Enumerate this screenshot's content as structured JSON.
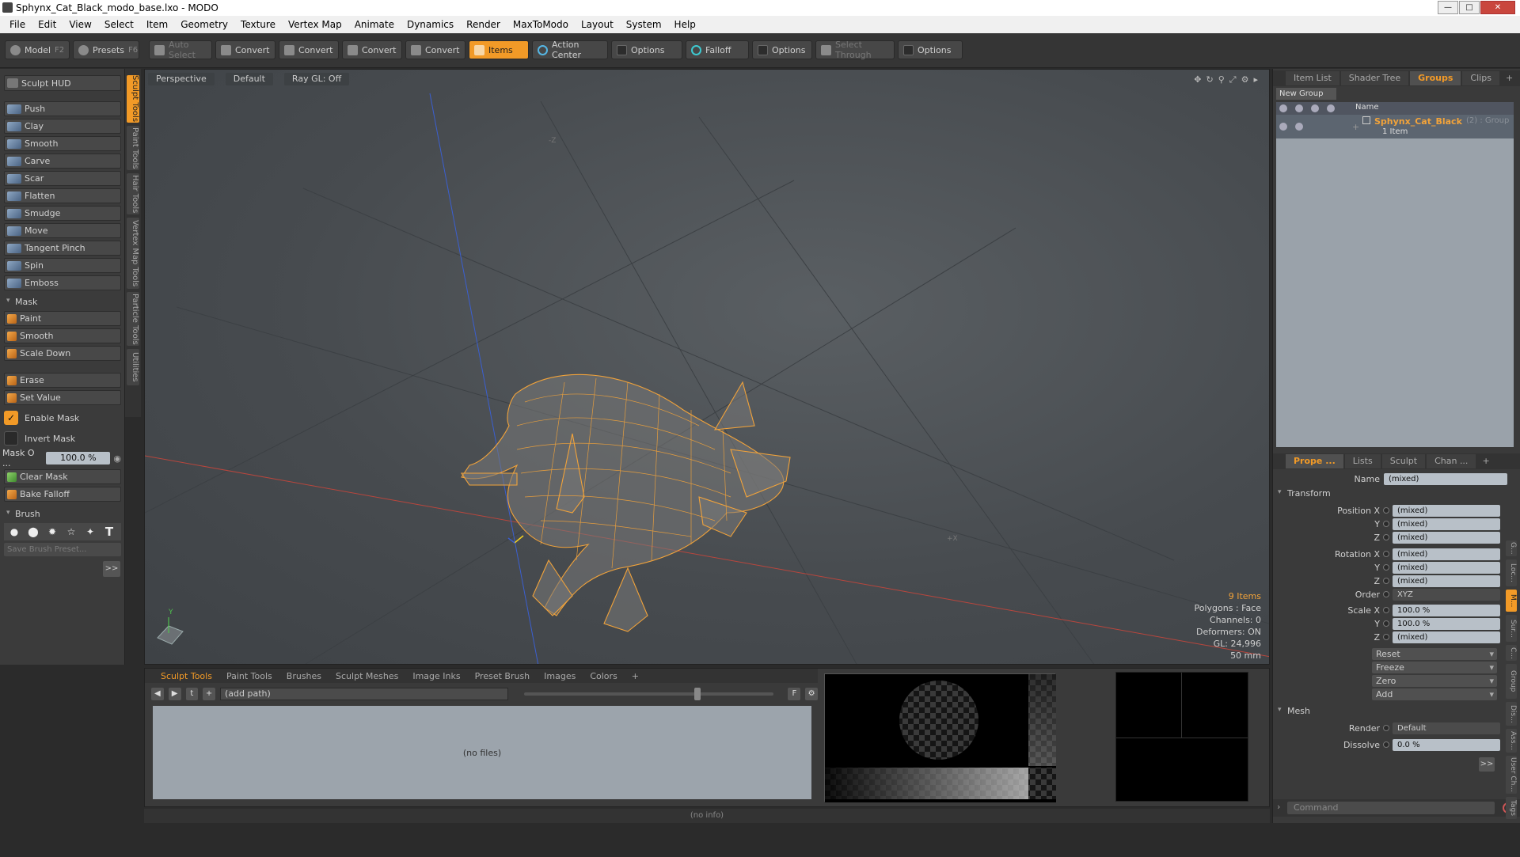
{
  "window": {
    "title": "Sphynx_Cat_Black_modo_base.lxo - MODO"
  },
  "menu": [
    "File",
    "Edit",
    "View",
    "Select",
    "Item",
    "Geometry",
    "Texture",
    "Vertex Map",
    "Animate",
    "Dynamics",
    "Render",
    "MaxToModo",
    "Layout",
    "System",
    "Help"
  ],
  "toolbar": {
    "model": "Model",
    "model_key": "F2",
    "presets": "Presets",
    "presets_key": "F6",
    "auto_select": "Auto Select",
    "convert1": "Convert",
    "convert2": "Convert",
    "convert3": "Convert",
    "convert4": "Convert",
    "items": "Items",
    "action_center": "Action Center",
    "options1": "Options",
    "falloff": "Falloff",
    "options2": "Options",
    "select_through": "Select Through",
    "options3": "Options"
  },
  "left": {
    "sculpt_hud": "Sculpt HUD",
    "tools": [
      "Push",
      "Clay",
      "Smooth",
      "Carve",
      "Scar",
      "Flatten",
      "Smudge",
      "Move",
      "Tangent Pinch",
      "Spin",
      "Emboss"
    ],
    "mask_header": "Mask",
    "mask_tools": [
      "Paint",
      "Smooth",
      "Scale Down"
    ],
    "erase": "Erase",
    "set_value": "Set Value",
    "enable_mask": "Enable Mask",
    "invert_mask": "Invert Mask",
    "mask_opacity_label": "Mask O ...",
    "mask_opacity_value": "100.0 %",
    "clear_mask": "Clear Mask",
    "bake_falloff": "Bake Falloff",
    "brush_header": "Brush",
    "save_preset": "Save Brush Preset...",
    "more": ">>",
    "vtabs": [
      "Sculpt Tools",
      "Paint Tools",
      "Hair Tools",
      "Vertex Map Tools",
      "Particle Tools",
      "Utilities"
    ]
  },
  "viewport": {
    "tab_view": "Perspective",
    "tab_shading": "Default",
    "tab_raygl": "Ray GL: Off",
    "stats": {
      "items": "9 Items",
      "polygons": "Polygons : Face",
      "channels": "Channels: 0",
      "deformers": "Deformers: ON",
      "gl": "GL: 24,996",
      "focal": "50 mm"
    }
  },
  "bottom": {
    "tabs": [
      "Sculpt Tools",
      "Paint Tools",
      "Brushes",
      "Sculpt Meshes",
      "Image Inks",
      "Preset Brush",
      "Images",
      "Colors"
    ],
    "path": "(add path)",
    "no_files": "(no files)",
    "status": "(no info)"
  },
  "right": {
    "top_tabs": [
      "Item List",
      "Shader Tree",
      "Groups",
      "Clips"
    ],
    "new_group": "New Group",
    "col_name": "Name",
    "group_name": "Sphynx_Cat_Black",
    "group_suffix": "(2) : Group",
    "group_count": "1 Item",
    "prop_tabs": [
      "Prope ...",
      "Lists",
      "Sculpt",
      "Chan ..."
    ],
    "name_label": "Name",
    "name_value": "(mixed)",
    "transform": "Transform",
    "position_x": "Position X",
    "pos_x": "(mixed)",
    "y": "Y",
    "pos_y": "(mixed)",
    "z": "Z",
    "pos_z": "(mixed)",
    "rotation_x": "Rotation X",
    "rot_x": "(mixed)",
    "rot_y": "(mixed)",
    "rot_z": "(mixed)",
    "order_label": "Order",
    "order_value": "XYZ",
    "scale_x": "Scale X",
    "sc_x": "100.0 %",
    "sc_y": "100.0 %",
    "sc_z": "(mixed)",
    "reset": "Reset",
    "freeze": "Freeze",
    "zero": "Zero",
    "add": "Add",
    "mesh": "Mesh",
    "render_label": "Render",
    "render_value": "Default",
    "dissolve_label": "Dissolve",
    "dissolve_value": "0.0 %",
    "more": ">>",
    "command": "Command",
    "side_tabs": [
      "G...",
      "Loc...",
      "M...",
      "Sur...",
      "C...",
      "Group",
      "Dis...",
      "Ass...",
      "User Ch...",
      "Tags"
    ]
  },
  "colors": {
    "accent": "#f29a27",
    "wire": "#f2a33a",
    "axis_x": "#c8443a",
    "axis_z": "#3a5fd0"
  }
}
